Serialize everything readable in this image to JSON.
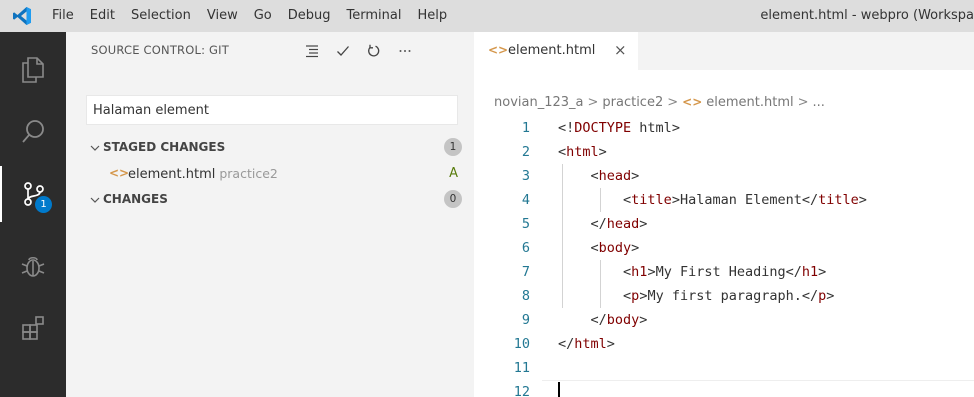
{
  "menu": [
    "File",
    "Edit",
    "Selection",
    "View",
    "Go",
    "Debug",
    "Terminal",
    "Help"
  ],
  "window_title": "element.html - webpro (Workspa",
  "activity_bar": {
    "items": [
      "explorer-icon",
      "search-icon",
      "source-control-icon",
      "debug-icon",
      "extensions-icon"
    ],
    "active": "source-control-icon",
    "source_control_badge": "1"
  },
  "sidebar": {
    "title": "SOURCE CONTROL: GIT",
    "commit_message": "Halaman element",
    "staged": {
      "label": "STAGED CHANGES",
      "count": "1",
      "files": [
        {
          "name": "element.html",
          "dir": "practice2",
          "status": "A"
        }
      ]
    },
    "changes": {
      "label": "CHANGES",
      "count": "0"
    }
  },
  "editor": {
    "tab": {
      "label": "element.html",
      "close": "×"
    },
    "breadcrumb": [
      "novian_123_a",
      "practice2",
      "element.html",
      "..."
    ],
    "lines": [
      {
        "n": "1",
        "text": "<!DOCTYPE html>"
      },
      {
        "n": "2",
        "text": "<html>"
      },
      {
        "n": "3",
        "text": "    <head>"
      },
      {
        "n": "4",
        "text": "        <title>Halaman Element</title>"
      },
      {
        "n": "5",
        "text": "    </head>"
      },
      {
        "n": "6",
        "text": "    <body>"
      },
      {
        "n": "7",
        "text": "        <h1>My First Heading</h1>"
      },
      {
        "n": "8",
        "text": "        <p>My first paragraph.</p>"
      },
      {
        "n": "9",
        "text": "    </body>"
      },
      {
        "n": "10",
        "text": "</html>"
      },
      {
        "n": "11",
        "text": ""
      },
      {
        "n": "12",
        "text": ""
      }
    ]
  },
  "colors": {
    "activity_bar": "#2c2c2c",
    "sidebar": "#f3f3f3",
    "tag": "#800000",
    "line_number": "#237893",
    "badge": "#007acc",
    "file_icon": "#d4964a",
    "added": "#587c0c"
  }
}
